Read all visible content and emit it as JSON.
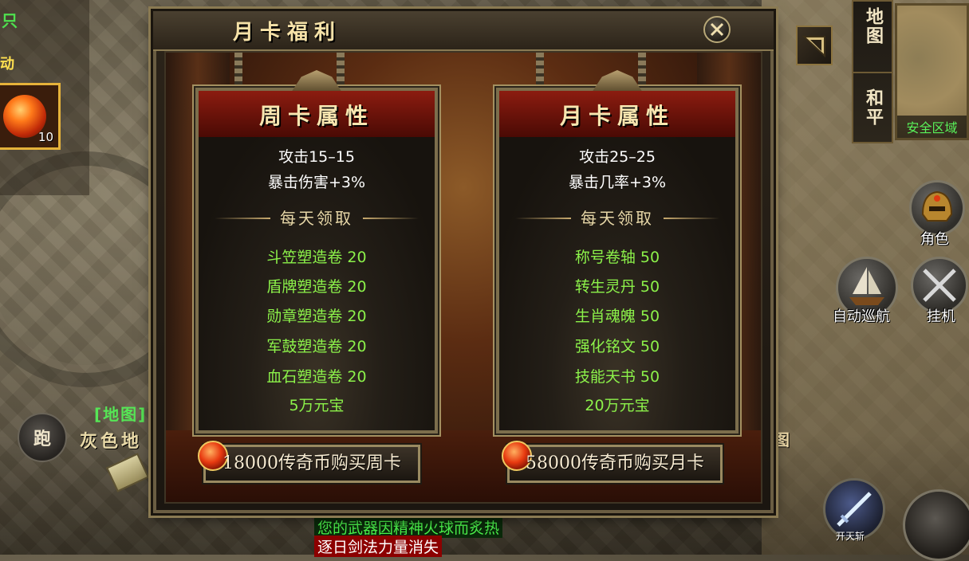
{
  "hud": {
    "top_left_text": "只",
    "action_text": "动",
    "skill_count": "10",
    "run_button": "跑",
    "map_tag": "[地图]",
    "ash_tag": "灰色地",
    "map_tab": "地图",
    "peace_tab": "和平",
    "minimap_label": "安全区域",
    "role_label": "角色",
    "autonav_label": "自动巡航",
    "idle_label": "挂机",
    "kaitian_label": "开天斩",
    "right_edge_char": "图"
  },
  "chat": {
    "line1": "您的武器因精神火球而炙热",
    "line2": "逐日剑法力量消失"
  },
  "panel": {
    "title": "月卡福利",
    "weekly": {
      "title": "周卡属性",
      "attrs": [
        "攻击15–15",
        "暴击伤害+3%"
      ],
      "daily_label": "每天领取",
      "rewards": [
        "斗笠塑造卷 20",
        "盾牌塑造卷 20",
        "勋章塑造卷 20",
        "军鼓塑造卷 20",
        "血石塑造卷 20",
        "5万元宝"
      ],
      "buy_label": "18000传奇币购买周卡"
    },
    "monthly": {
      "title": "月卡属性",
      "attrs": [
        "攻击25–25",
        "暴击几率+3%"
      ],
      "daily_label": "每天领取",
      "rewards": [
        "称号卷轴 50",
        "转生灵丹 50",
        "生肖魂魄 50",
        "强化铭文 50",
        "技能天书 50",
        "20万元宝"
      ],
      "buy_label": "58000传奇币购买月卡"
    }
  },
  "colors": {
    "reward_green": "#8cf24a",
    "title_gold": "#f8e6b0",
    "header_red": "#8c1c10",
    "chat_green": "#4cf24c",
    "chat_alert_bg": "#8c0000"
  },
  "icons": [
    "close-icon",
    "collapse-arrow-icon",
    "fire-orb-icon",
    "helmet-icon",
    "ship-icon",
    "crossed-swords-icon",
    "sword-skill-icon",
    "scroll-icon"
  ]
}
